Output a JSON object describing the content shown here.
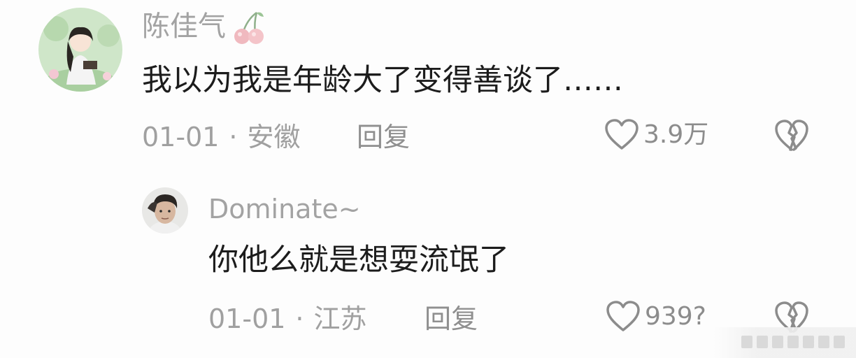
{
  "comment": {
    "username": "陈佳气",
    "username_emoji": "cherry-icon",
    "content": "我以为我是年龄大了变得善谈了……",
    "date": "01-01",
    "separator": "·",
    "location": "安徽",
    "reply_label": "回复",
    "like_count": "3.9万"
  },
  "reply": {
    "username": "Dominate~",
    "content": "你他么就是想耍流氓了",
    "date": "01-01",
    "separator": "·",
    "location": "江苏",
    "reply_label": "回复",
    "like_count": "939?"
  },
  "colors": {
    "background": "#fdfdfd",
    "username": "#a3a3a3",
    "content": "#1c1c1c",
    "meta": "#a0a0a0",
    "icon": "#8c8c8c"
  }
}
